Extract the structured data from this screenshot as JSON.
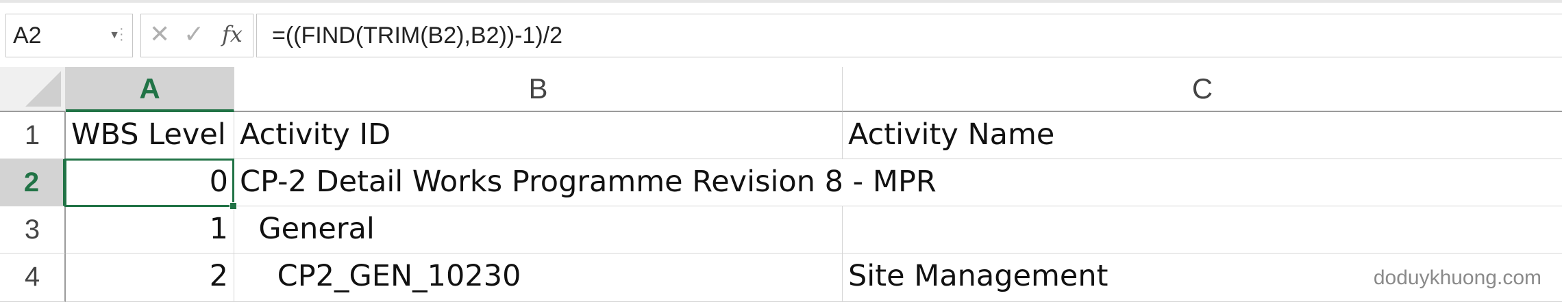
{
  "formula_bar": {
    "name_box": "A2",
    "formula": "=((FIND(TRIM(B2),B2))-1)/2",
    "buttons": {
      "cancel": "✕",
      "enter": "✓",
      "function": "fx"
    }
  },
  "columns": [
    "A",
    "B",
    "C"
  ],
  "selected_column": "A",
  "rows": [
    {
      "num": "1",
      "a": "WBS Level",
      "b": "Activity ID",
      "c": "Activity Name"
    },
    {
      "num": "2",
      "a": "0",
      "b": "CP-2 Detail Works Programme Revision 8 - MPR",
      "c": ""
    },
    {
      "num": "3",
      "a": "1",
      "b": "  General",
      "c": ""
    },
    {
      "num": "4",
      "a": "2",
      "b": "    CP2_GEN_10230",
      "c": "Site Management"
    }
  ],
  "selected_row": "2",
  "active_cell": "A2",
  "watermark": "doduykhuong.com",
  "colors": {
    "accent": "#217346",
    "header_bg": "#d3d3d3",
    "grid": "#d4d4d4"
  }
}
